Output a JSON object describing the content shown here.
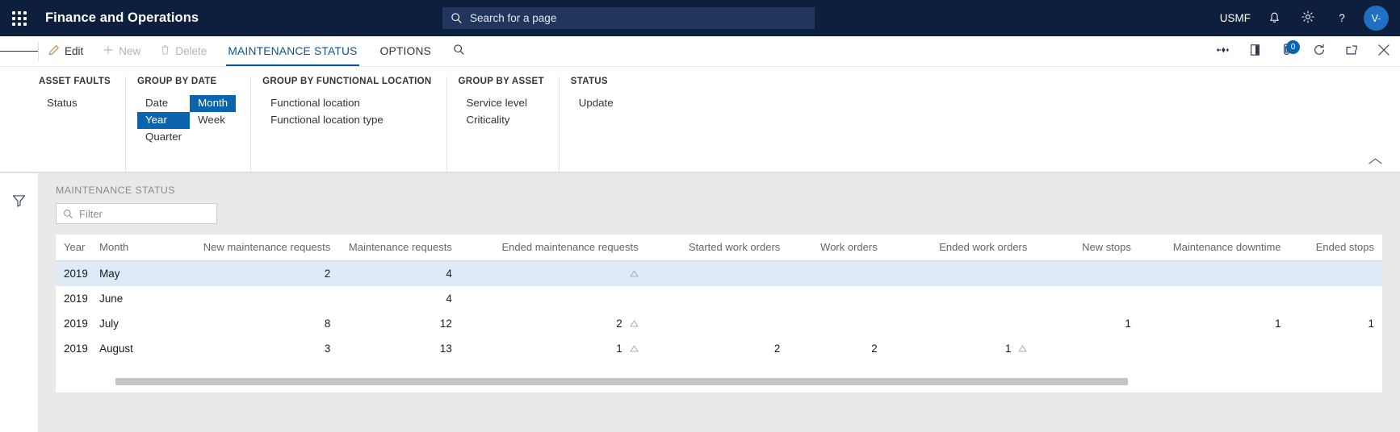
{
  "topbar": {
    "waffle_label": "waffle",
    "app_title": "Finance and Operations",
    "search_placeholder": "Search for a page",
    "search_value": "",
    "company": "USMF",
    "notifications_icon": "bell-icon",
    "settings_icon": "gear-icon",
    "help_label": "?",
    "avatar_initials": "V-",
    "accent": "#0d1f3c",
    "search_bg": "#21365c",
    "avatar_bg": "#1f6fc4"
  },
  "actionbar": {
    "edit_label": "Edit",
    "new_label": "New",
    "delete_label": "Delete",
    "tabs": [
      {
        "label": "MAINTENANCE STATUS",
        "active": true
      },
      {
        "label": "OPTIONS",
        "active": false
      }
    ],
    "search_icon": "search-icon",
    "right_icons": [
      {
        "name": "share-flow-icon"
      },
      {
        "name": "open-in-new-window-icon"
      },
      {
        "name": "attachments-icon",
        "badge": "0"
      },
      {
        "name": "refresh-icon"
      },
      {
        "name": "popout-icon"
      },
      {
        "name": "close-icon"
      }
    ],
    "badge_color": "#0b64b0",
    "active_tab_color": "#0b5394"
  },
  "action_pane": {
    "groups": [
      {
        "title": "ASSET FAULTS",
        "columns": [
          {
            "items": [
              {
                "label": "Status",
                "selected": false
              }
            ]
          }
        ]
      },
      {
        "title": "GROUP BY DATE",
        "columns": [
          {
            "items": [
              {
                "label": "Date",
                "selected": false
              },
              {
                "label": "Year",
                "selected": true
              },
              {
                "label": "Quarter",
                "selected": false
              }
            ]
          },
          {
            "items": [
              {
                "label": "Month",
                "selected": true
              },
              {
                "label": "Week",
                "selected": false
              }
            ]
          }
        ]
      },
      {
        "title": "GROUP BY FUNCTIONAL LOCATION",
        "columns": [
          {
            "items": [
              {
                "label": "Functional location",
                "selected": false
              },
              {
                "label": "Functional location type",
                "selected": false
              }
            ]
          }
        ]
      },
      {
        "title": "GROUP BY ASSET",
        "columns": [
          {
            "items": [
              {
                "label": "Service level",
                "selected": false
              },
              {
                "label": "Criticality",
                "selected": false
              }
            ]
          }
        ]
      },
      {
        "title": "STATUS",
        "columns": [
          {
            "items": [
              {
                "label": "Update",
                "selected": false
              }
            ]
          }
        ]
      }
    ],
    "collapse_icon": "chevron-up-icon",
    "selected_bg": "#0b64b0"
  },
  "leftrail": {
    "filter_icon": "funnel-filter-icon"
  },
  "grid_section": {
    "section_title": "MAINTENANCE STATUS",
    "filter_placeholder": "Filter",
    "filter_value": "",
    "filter_icon": "search-icon"
  },
  "grid": {
    "columns": [
      {
        "key": "year",
        "label": "Year",
        "align": "left",
        "width": "44"
      },
      {
        "key": "month",
        "label": "Month",
        "align": "left",
        "width": "120"
      },
      {
        "key": "new_mr",
        "label": "New maintenance requests",
        "align": "right",
        "width": "185"
      },
      {
        "key": "mr",
        "label": "Maintenance requests",
        "align": "right",
        "width": "150"
      },
      {
        "key": "end_mr",
        "label": "Ended maintenance requests",
        "align": "right",
        "width": "230"
      },
      {
        "key": "st_wo",
        "label": "Started work orders",
        "align": "right",
        "width": "175"
      },
      {
        "key": "wo",
        "label": "Work orders",
        "align": "right",
        "width": "120"
      },
      {
        "key": "end_wo",
        "label": "Ended work orders",
        "align": "right",
        "width": "185"
      },
      {
        "key": "new_st",
        "label": "New stops",
        "align": "right",
        "width": "128"
      },
      {
        "key": "down",
        "label": "Maintenance downtime",
        "align": "right",
        "width": "185"
      },
      {
        "key": "end_st",
        "label": "Ended stops",
        "align": "right",
        "width": "115"
      }
    ],
    "rows": [
      {
        "selected": true,
        "cells": {
          "year": "2019",
          "month": "May",
          "new_mr": "2",
          "mr": "4",
          "end_mr": "",
          "end_mr_icon": true,
          "st_wo": "",
          "wo": "",
          "end_wo": "",
          "end_wo_icon": false,
          "new_st": "",
          "down": "",
          "end_st": ""
        }
      },
      {
        "selected": false,
        "cells": {
          "year": "2019",
          "month": "June",
          "new_mr": "",
          "mr": "4",
          "end_mr": "",
          "end_mr_icon": false,
          "st_wo": "",
          "wo": "",
          "end_wo": "",
          "end_wo_icon": false,
          "new_st": "",
          "down": "",
          "end_st": ""
        }
      },
      {
        "selected": false,
        "cells": {
          "year": "2019",
          "month": "July",
          "new_mr": "8",
          "mr": "12",
          "end_mr": "2",
          "end_mr_icon": true,
          "st_wo": "",
          "wo": "",
          "end_wo": "",
          "end_wo_icon": false,
          "new_st": "1",
          "down": "1",
          "end_st": "1"
        }
      },
      {
        "selected": false,
        "cells": {
          "year": "2019",
          "month": "August",
          "new_mr": "3",
          "mr": "13",
          "end_mr": "1",
          "end_mr_icon": true,
          "st_wo": "2",
          "wo": "2",
          "end_wo": "1",
          "end_wo_icon": true,
          "new_st": "",
          "down": "",
          "end_st": ""
        }
      }
    ],
    "selected_row_bg": "#deebf7"
  },
  "scrollbar": {
    "orientation": "horizontal",
    "thumb_color": "#c4c4c4"
  }
}
